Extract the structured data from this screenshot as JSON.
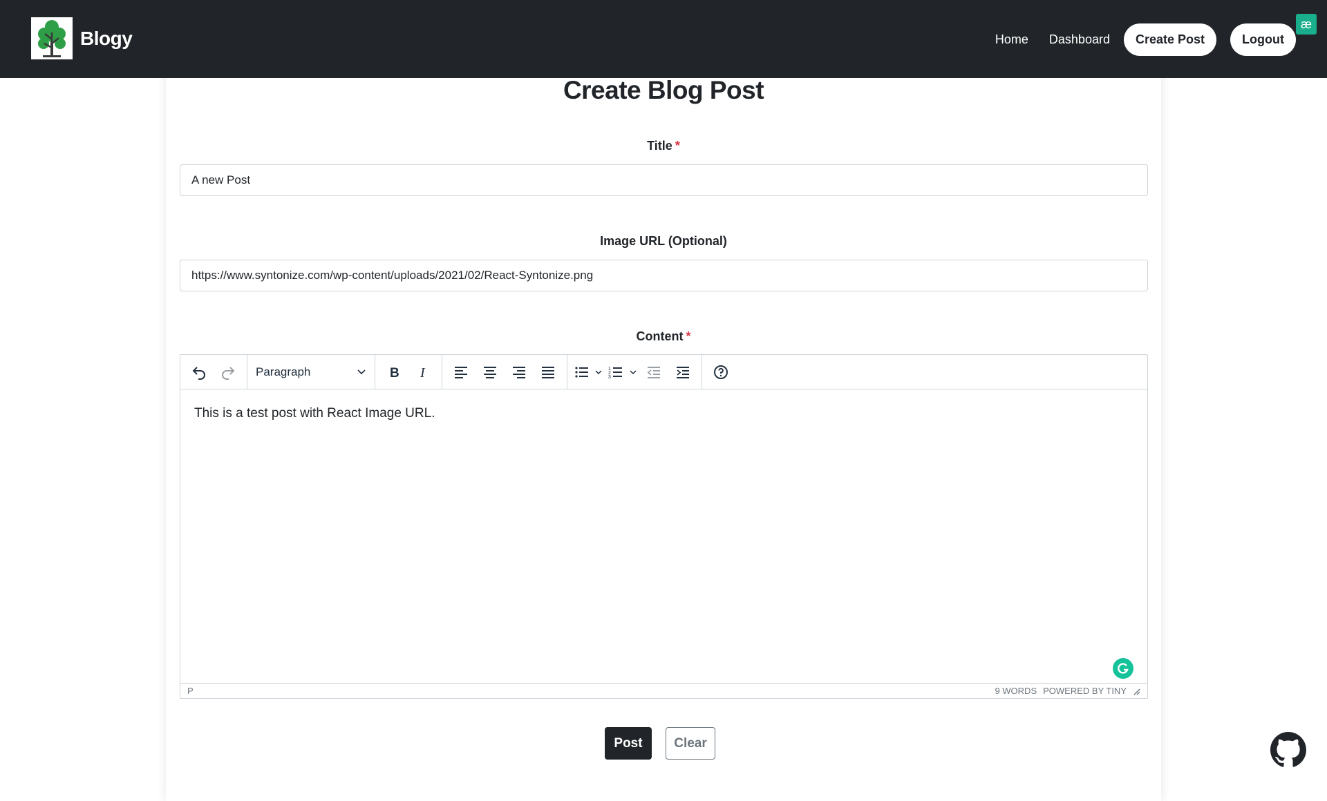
{
  "navbar": {
    "brand": "Blogy",
    "links": {
      "home": "Home",
      "dashboard": "Dashboard",
      "create_post": "Create Post",
      "logout": "Logout"
    },
    "extension_badge": "æ"
  },
  "page": {
    "title": "Create Blog Post"
  },
  "form": {
    "title_label": "Title",
    "title_value": "A new Post",
    "image_label": "Image URL (Optional)",
    "image_value": "https://www.syntonize.com/wp-content/uploads/2021/02/React-Syntonize.png",
    "content_label": "Content",
    "required_marker": "*"
  },
  "editor": {
    "block_format": "Paragraph",
    "content": "This is a test post with React Image URL.",
    "status_path": "P",
    "word_count": "9 WORDS",
    "powered_by": "POWERED BY TINY"
  },
  "actions": {
    "post": "Post",
    "clear": "Clear"
  },
  "colors": {
    "navbar_bg": "#212529",
    "required": "#dc3545",
    "logo_green": "#2e9e47",
    "grammarly": "#15c39a"
  }
}
